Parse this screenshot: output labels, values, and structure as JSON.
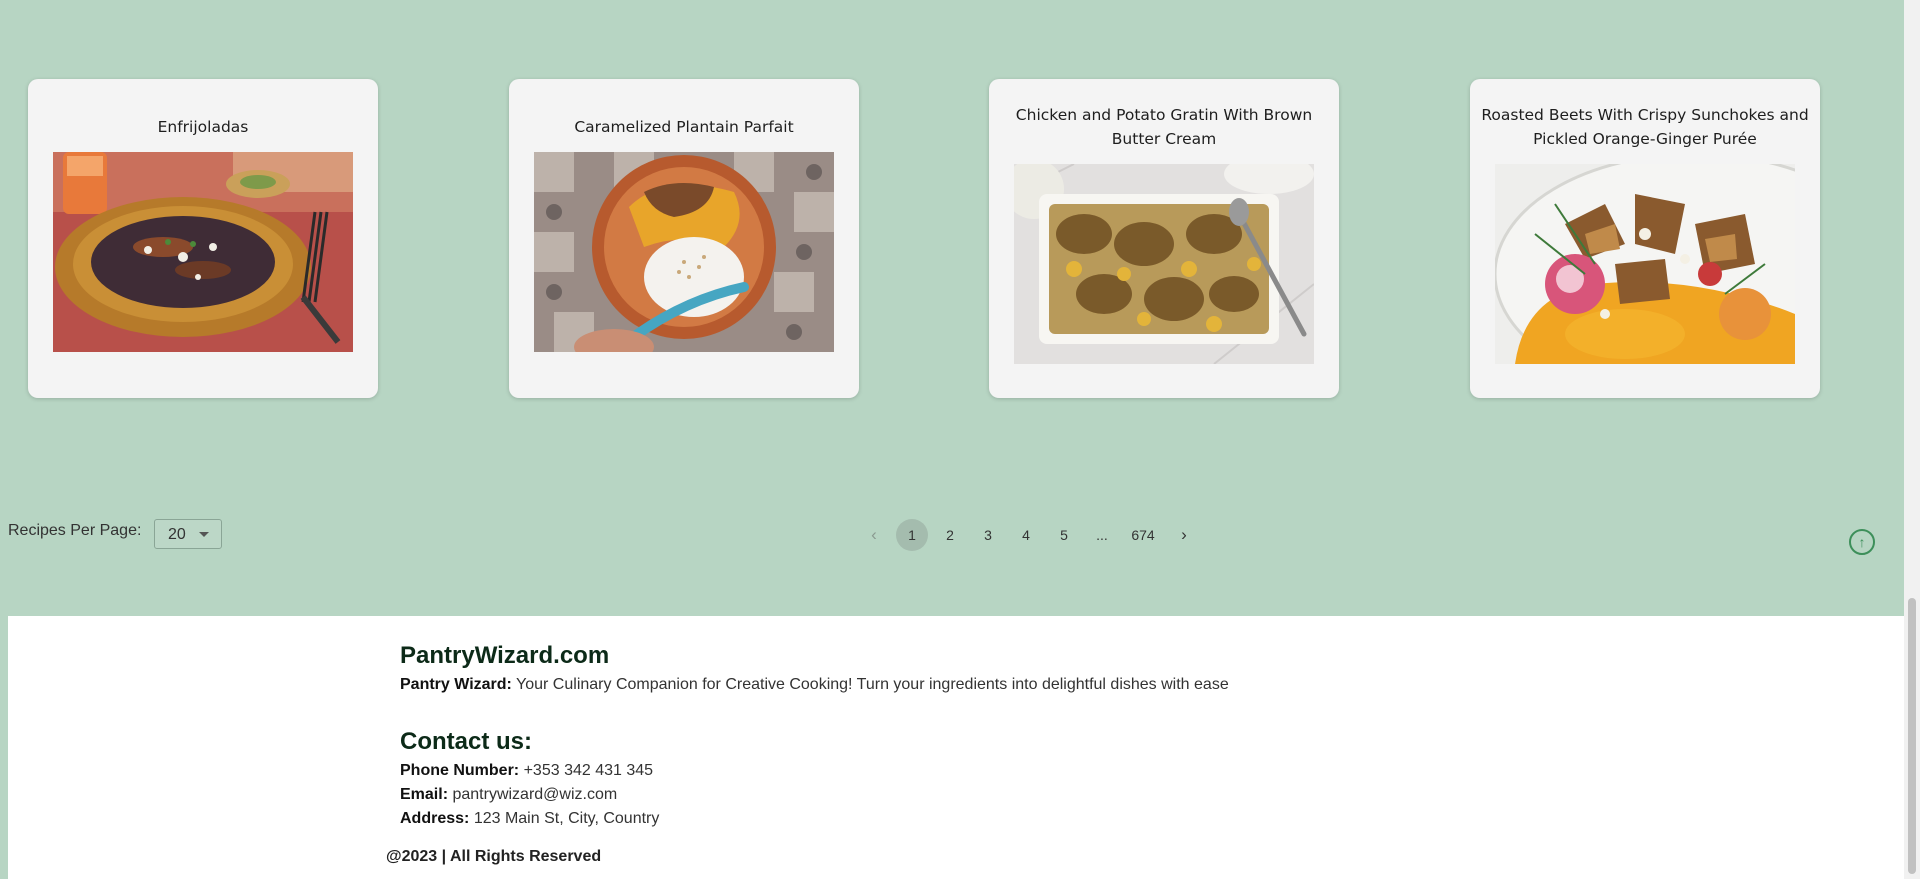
{
  "recipes": [
    {
      "title": "Enfrijoladas"
    },
    {
      "title": "Caramelized Plantain Parfait"
    },
    {
      "title": "Chicken and Potato Gratin With Brown Butter Cream"
    },
    {
      "title": "Roasted Beets With Crispy Sunchokes and Pickled Orange-Ginger Purée"
    }
  ],
  "controls": {
    "per_page_label": "Recipes Per Page:",
    "per_page_value": "20"
  },
  "pagination": {
    "prev_icon": "chevron-left-icon",
    "next_icon": "chevron-right-icon",
    "pages": [
      "1",
      "2",
      "3",
      "4",
      "5",
      "...",
      "674"
    ],
    "current_page": "1"
  },
  "scroll_top_icon": "arrow-up-circle-icon",
  "footer": {
    "brand": "PantryWizard.com",
    "tagline_label": "Pantry Wizard:",
    "tagline_text": "Your Culinary Companion for Creative Cooking! Turn your ingredients into delightful dishes with ease",
    "contact_heading": "Contact us:",
    "phone_label": "Phone Number:",
    "phone_value": "+353 342 431 345",
    "email_label": "Email:",
    "email_value": "pantrywizard@wiz.com",
    "address_label": "Address:",
    "address_value": "123 Main St, City, Country",
    "copyright": "@2023 | All Rights Reserved"
  },
  "colors": {
    "page_background": "#b7d5c3",
    "card_background": "#f4f4f4",
    "active_page": "#a4bcae",
    "accent_green": "#3d8f5a",
    "footer_background": "#ffffff"
  }
}
